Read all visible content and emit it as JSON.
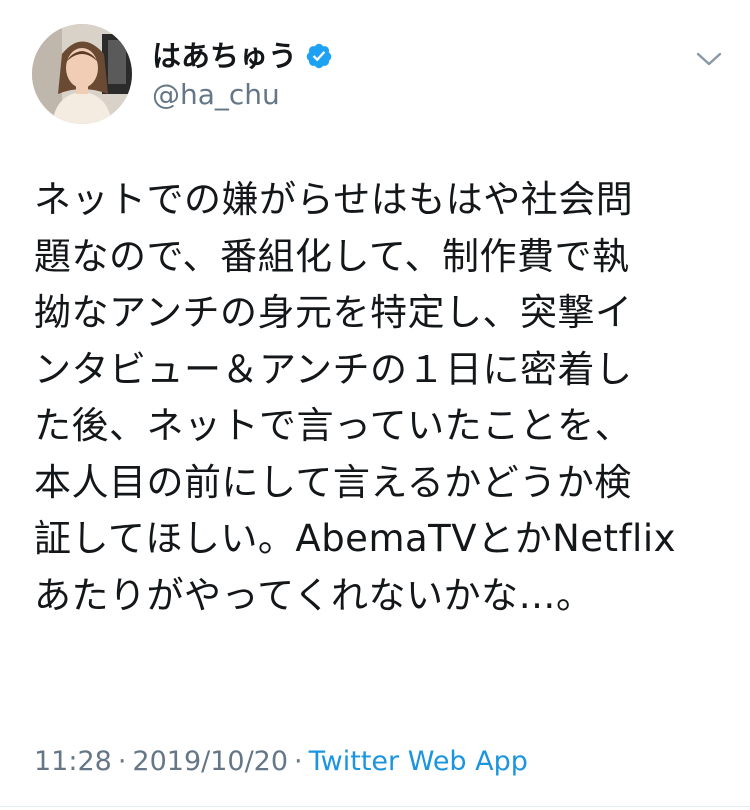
{
  "user": {
    "display_name": "はあちゅう",
    "handle": "@ha_chu",
    "verified_icon": "verified-badge-icon",
    "avatar_icon": "avatar"
  },
  "menu": {
    "icon": "chevron-down-icon"
  },
  "tweet": {
    "lines": [
      "ネットでの嫌がらせはもはや社会問",
      "題なので、番組化して、制作費で執",
      "拗なアンチの身元を特定し、突撃イ",
      "ンタビュー＆アンチの１日に密着し",
      "た後、ネットで言っていたことを、",
      "本人目の前にして言えるかどうか検",
      "証してほしい。AbemaTVとかNetflix",
      "あたりがやってくれないかな…。"
    ]
  },
  "meta": {
    "time": "11:28",
    "date": "2019/10/20",
    "separator": "·",
    "source": "Twitter Web App"
  },
  "colors": {
    "text": "#14171a",
    "secondary": "#657786",
    "link": "#1b95e0",
    "verified": "#1da1f2"
  }
}
